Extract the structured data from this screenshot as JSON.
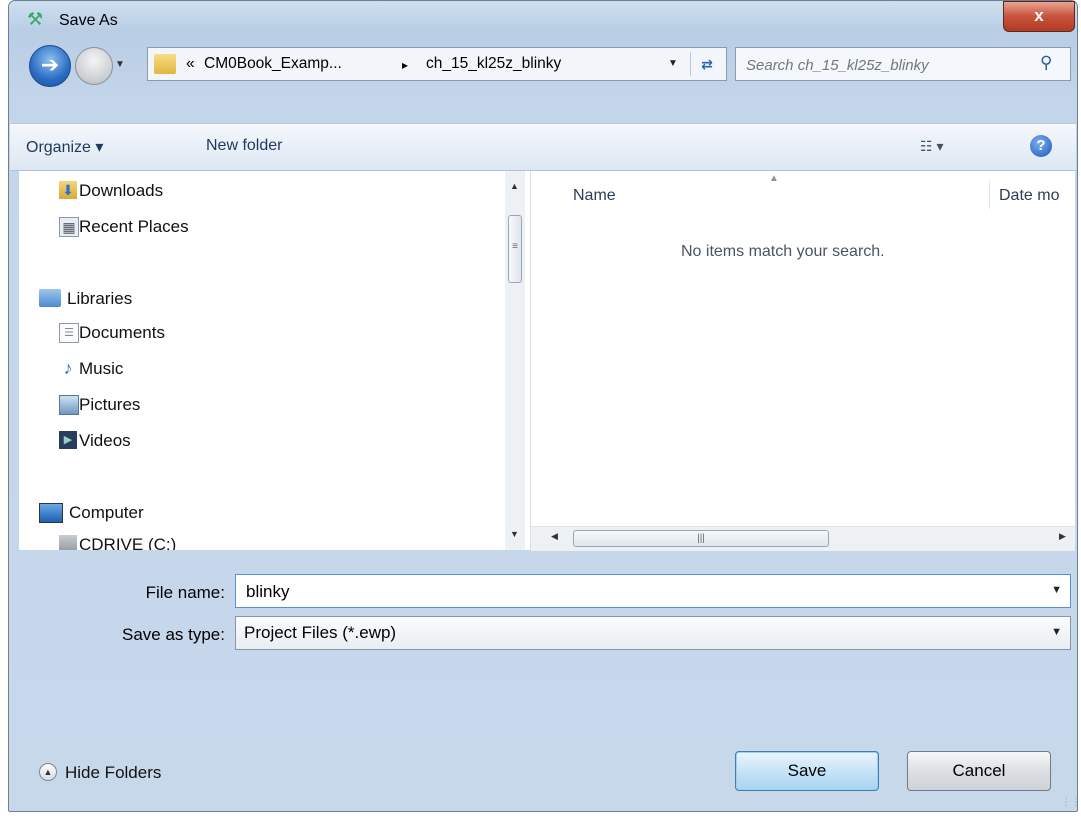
{
  "window": {
    "title": "Save As",
    "close_label": "x"
  },
  "address_bar": {
    "overflow": "«",
    "breadcrumbs": [
      "CM0Book_Examp...",
      "ch_15_kl25z_blinky"
    ],
    "separator": "▸"
  },
  "search": {
    "placeholder": "Search ch_15_kl25z_blinky"
  },
  "toolbar": {
    "organize_label": "Organize ▾",
    "new_folder_label": "New folder",
    "views_label": "☷ ▾",
    "help_label": "?"
  },
  "nav_pane": {
    "items": [
      {
        "label": "Downloads",
        "icon": "downloads-icon"
      },
      {
        "label": "Recent Places",
        "icon": "recent-places-icon"
      },
      {
        "label": "Libraries",
        "icon": "libraries-icon"
      },
      {
        "label": "Documents",
        "icon": "documents-icon"
      },
      {
        "label": "Music",
        "icon": "music-icon"
      },
      {
        "label": "Pictures",
        "icon": "pictures-icon"
      },
      {
        "label": "Videos",
        "icon": "videos-icon"
      },
      {
        "label": "Computer",
        "icon": "computer-icon"
      },
      {
        "label": "CDRIVE (C:)",
        "icon": "drive-icon"
      }
    ]
  },
  "file_list": {
    "columns": [
      "Name",
      "Date mo"
    ],
    "empty_message": "No items match your search."
  },
  "form": {
    "file_name_label": "File name:",
    "file_name_value": "blinky",
    "save_type_label": "Save as type:",
    "save_type_value": "Project Files (*.ewp)"
  },
  "footer": {
    "hide_folders_label": "Hide Folders",
    "save_label": "Save",
    "cancel_label": "Cancel"
  }
}
